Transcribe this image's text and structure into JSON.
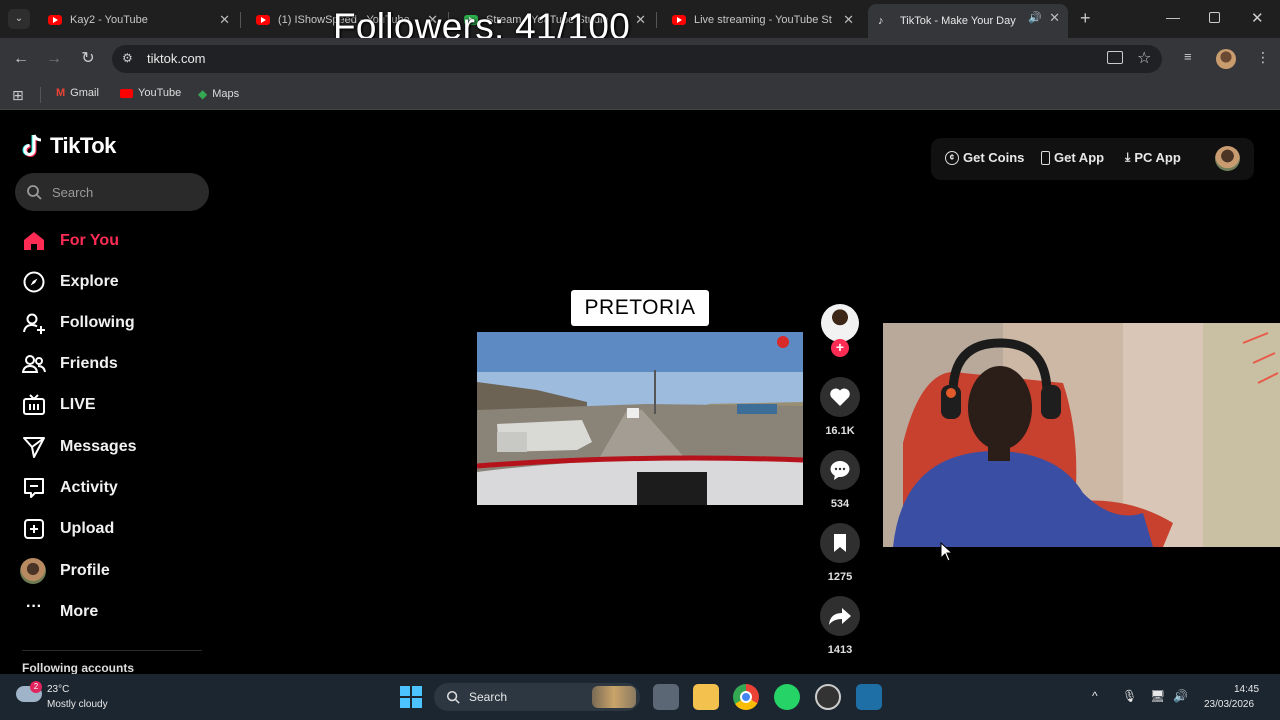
{
  "browser": {
    "tabs": [
      {
        "title": "Kay2 - YouTube"
      },
      {
        "title": "(1) IShowSpeed - YouTube"
      },
      {
        "title": "Stream - YouTube Studio"
      },
      {
        "title": "Live streaming - YouTube St"
      },
      {
        "title": "TikTok - Make Your Day",
        "active": true
      }
    ],
    "url": "tiktok.com",
    "bookmarks": [
      {
        "label": "Gmail"
      },
      {
        "label": "YouTube"
      },
      {
        "label": "Maps"
      }
    ]
  },
  "overlay": {
    "followers_text": "Followers: 41/100",
    "followers_current": 41,
    "followers_goal": 100
  },
  "tiktok": {
    "logo": "TikTok",
    "search_placeholder": "Search",
    "nav": [
      {
        "label": "For You",
        "icon": "home-icon",
        "active": true
      },
      {
        "label": "Explore",
        "icon": "compass-icon"
      },
      {
        "label": "Following",
        "icon": "person-add-icon"
      },
      {
        "label": "Friends",
        "icon": "friends-icon"
      },
      {
        "label": "LIVE",
        "icon": "live-tv-icon"
      },
      {
        "label": "Messages",
        "icon": "send-icon"
      },
      {
        "label": "Activity",
        "icon": "message-box-icon"
      },
      {
        "label": "Upload",
        "icon": "plus-square-icon"
      },
      {
        "label": "Profile",
        "icon": "avatar-icon"
      },
      {
        "label": "More",
        "icon": "more-dots-icon"
      }
    ],
    "following_accounts": "Following accounts",
    "top_actions": {
      "get_coins": "Get Coins",
      "get_app": "Get App",
      "pc_app": "PC App"
    },
    "video": {
      "caption_overlay": "PRETORIA"
    },
    "actions": {
      "likes": "16.1K",
      "comments": "534",
      "saves": "1275",
      "shares": "1413"
    }
  },
  "taskbar": {
    "weather_temp": "23°C",
    "weather_desc": "Mostly cloudy",
    "weather_badge": "2",
    "search_label": "Search",
    "time": "14:45",
    "date": "23/03/2026"
  },
  "colors": {
    "tiktok_accent": "#fe2c55",
    "page_bg": "#000000",
    "browser_chrome": "#35363a"
  }
}
